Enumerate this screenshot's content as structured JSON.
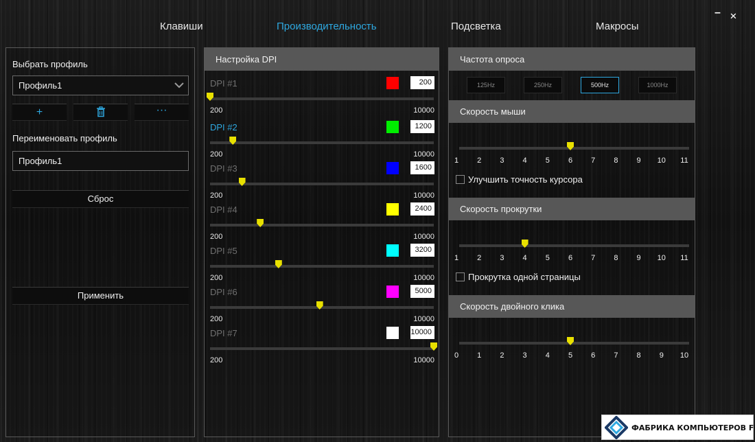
{
  "nav": {
    "tabs": [
      {
        "label": "Клавиши"
      },
      {
        "label": "Производительность"
      },
      {
        "label": "Подсветка"
      },
      {
        "label": "Макросы"
      }
    ],
    "active_tab": "Производительность",
    "minimize_glyph": "–",
    "close_glyph": "✕"
  },
  "left": {
    "select_profile_label": "Выбрать профиль",
    "selected_profile": "Профиль1",
    "add_icon": "+",
    "more_icon": "···",
    "rename_label": "Переименовать профиль",
    "rename_value": "Профиль1",
    "reset_label": "Сброс",
    "apply_label": "Применить"
  },
  "dpi": {
    "title": "Настройка DPI",
    "min": 200,
    "max": 10000,
    "min_label": "200",
    "max_label": "10000",
    "active_index": 1,
    "levels": [
      {
        "name": "DPI #1",
        "value": "200",
        "color": "#ff0000"
      },
      {
        "name": "DPI #2",
        "value": "1200",
        "color": "#00ee00"
      },
      {
        "name": "DPI #3",
        "value": "1600",
        "color": "#0000ff"
      },
      {
        "name": "DPI #4",
        "value": "2400",
        "color": "#ffff00"
      },
      {
        "name": "DPI #5",
        "value": "3200",
        "color": "#00ffff"
      },
      {
        "name": "DPI #6",
        "value": "5000",
        "color": "#ff00ff"
      },
      {
        "name": "DPI #7",
        "value": "10000",
        "color": "#ffffff"
      }
    ]
  },
  "polling": {
    "title": "Частота опроса",
    "options": [
      "125Hz",
      "250Hz",
      "500Hz",
      "1000Hz"
    ],
    "selected": "500Hz"
  },
  "mouse_speed": {
    "title": "Скорость мыши",
    "ticks": [
      "1",
      "2",
      "3",
      "4",
      "5",
      "6",
      "7",
      "8",
      "9",
      "10",
      "11"
    ],
    "value": 6,
    "checkbox_label": "Улучшить точность курсора",
    "checked": false
  },
  "scroll_speed": {
    "title": "Скорость прокрутки",
    "ticks": [
      "1",
      "2",
      "3",
      "4",
      "5",
      "6",
      "7",
      "8",
      "9",
      "10",
      "11"
    ],
    "value": 4,
    "checkbox_label": "Прокрутка одной страницы",
    "checked": false
  },
  "double_click": {
    "title": "Скорость двойного клика",
    "ticks": [
      "0",
      "1",
      "2",
      "3",
      "4",
      "5",
      "6",
      "7",
      "8",
      "9",
      "10"
    ],
    "value": 5
  },
  "watermark": {
    "text": "ФАБРИКА КОМПЬЮТЕРОВ FK.BY"
  },
  "colors": {
    "accent": "#2ea8e0",
    "thumb": "#e8e000",
    "header": "#575757"
  }
}
